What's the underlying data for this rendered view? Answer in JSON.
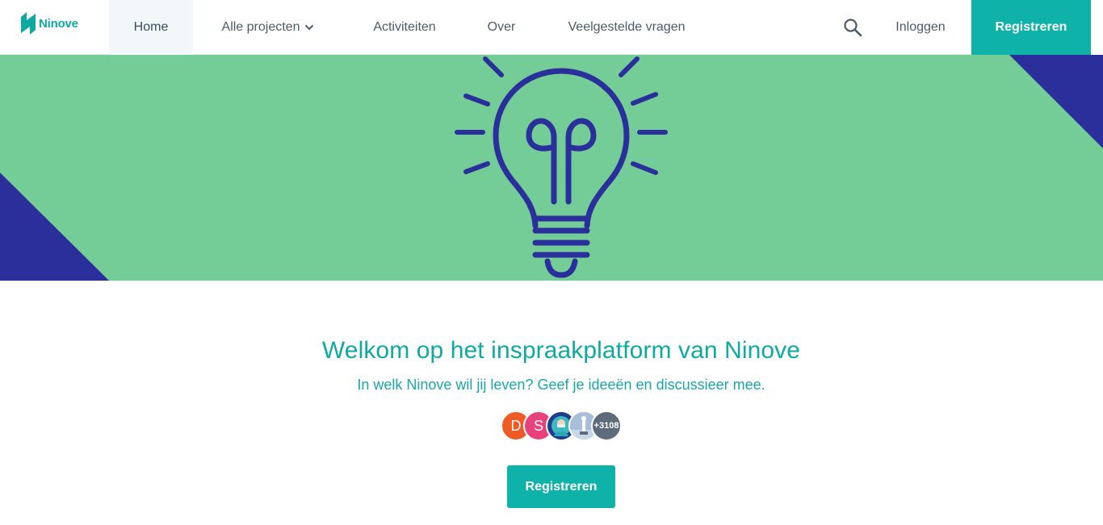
{
  "header": {
    "logo_text": "Ninove",
    "nav": {
      "home": "Home",
      "projects": "Alle projecten",
      "activities": "Activiteiten",
      "about": "Over",
      "faq": "Veelgestelde vragen"
    },
    "search_icon": "search-icon",
    "login": "Inloggen",
    "register": "Registreren"
  },
  "banner": {
    "illustration": "lightbulb-icon",
    "colors": {
      "background": "#74cc97",
      "accent": "#2b2f9c"
    }
  },
  "welcome": {
    "title": "Welkom op het inspraakplatform van Ninove",
    "subtitle": "In welk Ninove wil jij leven? Geef je ideeën en discussieer mee.",
    "avatars": [
      {
        "initial": "D",
        "color": "#f05a24"
      },
      {
        "initial": "S",
        "color": "#e8417c"
      },
      {
        "initial": "",
        "color": "#1d3f8c"
      },
      {
        "initial": "",
        "color": "#8fa8c8"
      }
    ],
    "more_count": "+3108",
    "register": "Registreren"
  },
  "colors": {
    "brand": "#0fb2a9",
    "text": "#4c5b6a"
  }
}
